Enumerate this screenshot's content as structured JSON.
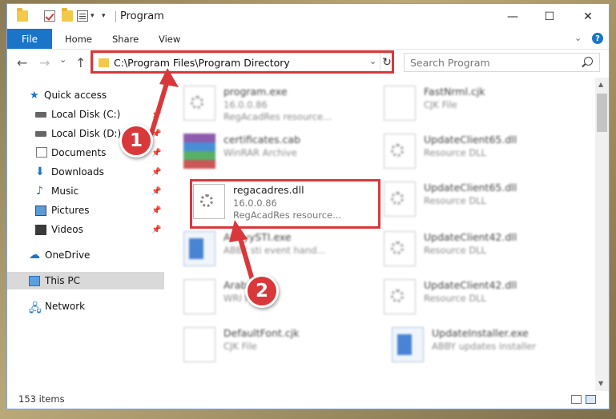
{
  "window": {
    "title": "Program",
    "controls": {
      "minimize": "—",
      "maximize": "☐",
      "close": "✕"
    }
  },
  "ribbon": {
    "tabs": [
      "File",
      "Home",
      "Share",
      "View"
    ],
    "expand": "⌄",
    "help": "?"
  },
  "address": {
    "path": "C:\\Program Files\\Program Directory",
    "dropdown": "⌄",
    "refresh": "↻"
  },
  "search": {
    "placeholder": "Search Program"
  },
  "nav_buttons": {
    "back": "←",
    "forward": "→",
    "recent": "⌄",
    "up": "↑"
  },
  "sidebar": {
    "items": [
      {
        "label": "Quick access",
        "icon": "star-icon"
      },
      {
        "label": "Local Disk (C:)",
        "icon": "disk-icon",
        "pinned": true
      },
      {
        "label": "Local Disk (D:)",
        "icon": "disk-icon",
        "pinned": true
      },
      {
        "label": "Documents",
        "icon": "documents-icon",
        "pinned": true
      },
      {
        "label": "Downloads",
        "icon": "download-icon",
        "pinned": true
      },
      {
        "label": "Music",
        "icon": "music-icon",
        "pinned": true
      },
      {
        "label": "Pictures",
        "icon": "pictures-icon",
        "pinned": true
      },
      {
        "label": "Videos",
        "icon": "videos-icon",
        "pinned": true
      },
      {
        "label": "OneDrive",
        "icon": "cloud-icon"
      },
      {
        "label": "This PC",
        "icon": "computer-icon",
        "selected": true
      },
      {
        "label": "Network",
        "icon": "network-icon"
      }
    ],
    "pin_glyph": "📌"
  },
  "files": [
    {
      "name": "program.exe",
      "line2": "16.0.0.86",
      "line3": "RegAcadRes resource..."
    },
    {
      "name": "FastNrml.cjk",
      "line2": "CJK File",
      "line3": ""
    },
    {
      "name": "certificates.cab",
      "line2": "WinRAR Archive",
      "line3": ""
    },
    {
      "name": "UpdateClient65.dll",
      "line2": "Resource DLL",
      "line3": ""
    },
    {
      "name": "regacadres.dll",
      "line2": "16.0.0.86",
      "line3": "RegAcadRes resource..."
    },
    {
      "name": "UpdateClient65.dll",
      "line2": "Resource DLL",
      "line3": ""
    },
    {
      "name": "AbbyySTI.exe",
      "line2": "ABBY sti event hand...",
      "line3": ""
    },
    {
      "name": "UpdateClient42.dll",
      "line2": "Resource DLL",
      "line3": ""
    },
    {
      "name": "ArabicFont",
      "line2": "WRI File",
      "line3": ""
    },
    {
      "name": "UpdateClient42.dll",
      "line2": "Resource DLL",
      "line3": ""
    },
    {
      "name": "DefaultFont.cjk",
      "line2": "CJK File",
      "line3": ""
    },
    {
      "name": "UpdateInstaller.exe",
      "line2": "ABBY updates installer",
      "line3": ""
    }
  ],
  "status": {
    "count": "153 items"
  },
  "callouts": {
    "one": "1",
    "two": "2"
  },
  "colors": {
    "accent": "#1a75c9",
    "highlight": "#d9383b",
    "selected_nav": "#d9d9d9"
  }
}
